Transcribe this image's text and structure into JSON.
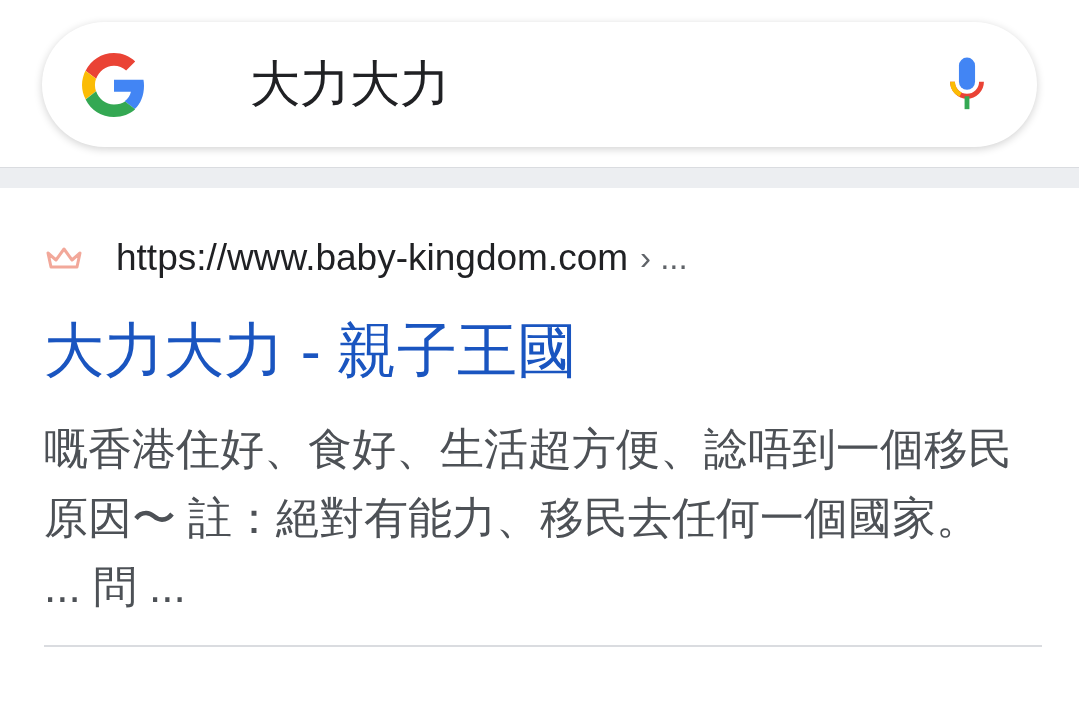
{
  "search": {
    "value": "大力大力"
  },
  "result": {
    "url": "https://www.baby-kingdom.com",
    "breadcrumb": "› ...",
    "title": "大力大力 - 親子王國",
    "snippet": "嘅香港住好、食好、生活超方便、諗唔到一個移民原因〜 註：絕對有能力、移民去任何一個國家。 ... 問 ..."
  }
}
